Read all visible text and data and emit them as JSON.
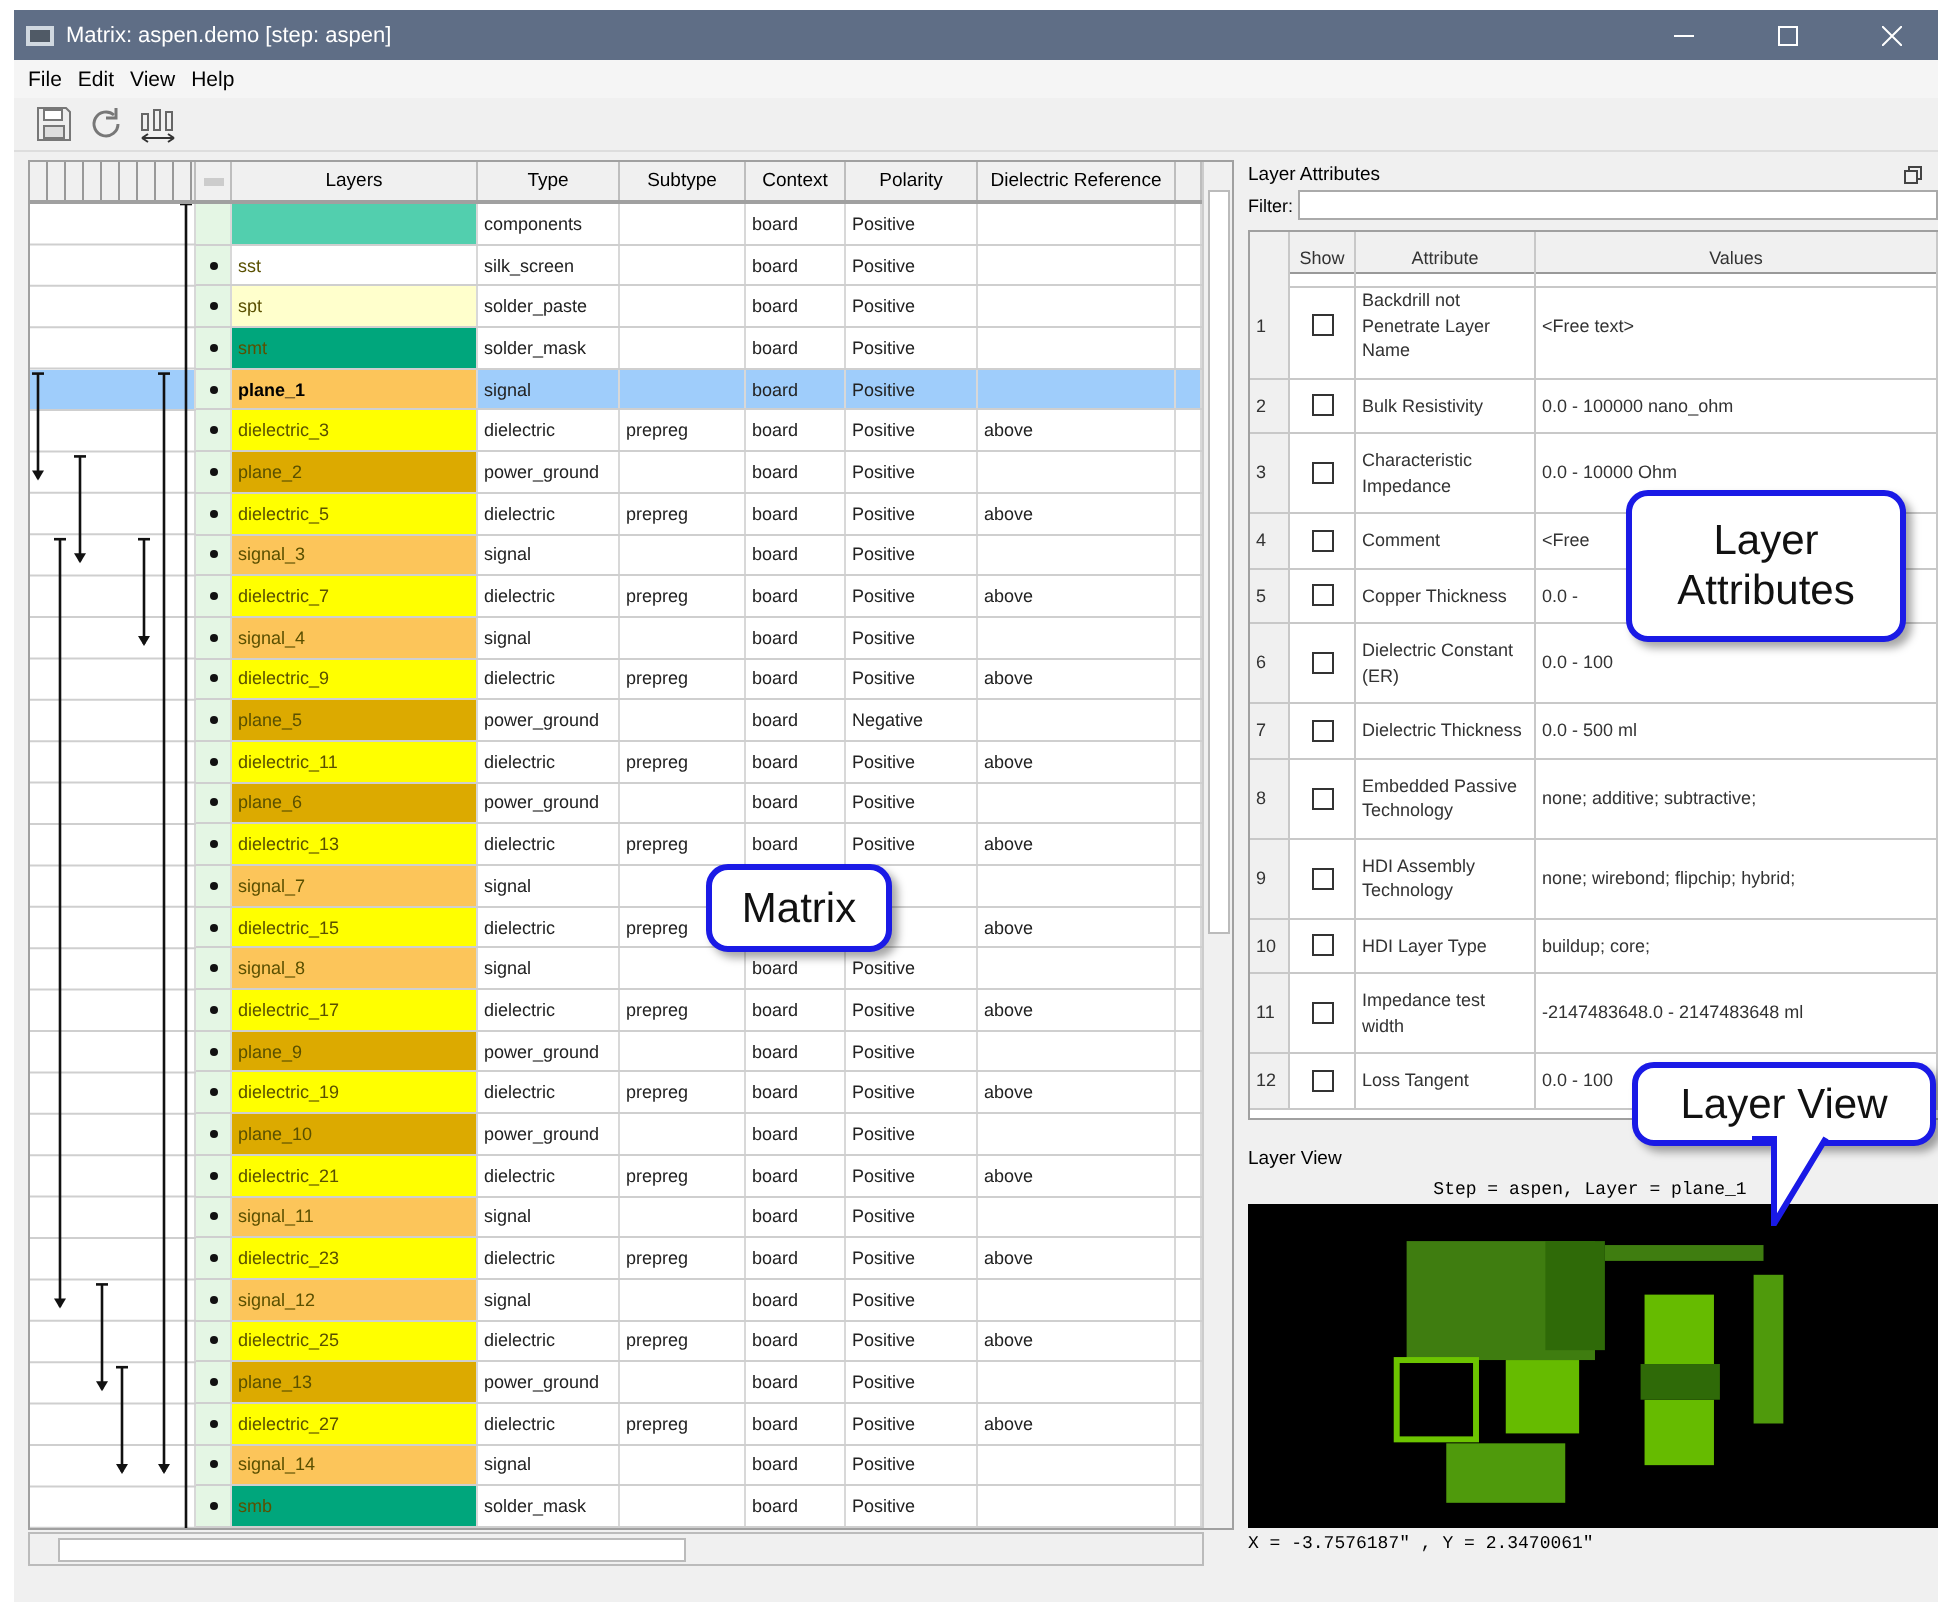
{
  "window": {
    "title": "Matrix: aspen.demo [step: aspen]"
  },
  "menu": [
    "File",
    "Edit",
    "View",
    "Help"
  ],
  "matrix": {
    "columns": [
      "Layers",
      "Type",
      "Subtype",
      "Context",
      "Polarity",
      "Dielectric Reference"
    ],
    "rows": [
      {
        "marked": false,
        "selected": false,
        "color": "#52cfae",
        "type": "components",
        "context": "board",
        "polarity": "Positive"
      },
      {
        "layer": "sst",
        "marked": true,
        "selected": false,
        "color": "#ffffff",
        "type": "silk_screen",
        "context": "board",
        "polarity": "Positive"
      },
      {
        "layer": "spt",
        "marked": true,
        "selected": false,
        "color": "#ffffcc",
        "type": "solder_paste",
        "context": "board",
        "polarity": "Positive"
      },
      {
        "layer": "smt",
        "marked": true,
        "selected": false,
        "color": "#00a67c",
        "type": "solder_mask",
        "context": "board",
        "polarity": "Positive"
      },
      {
        "layer": "plane_1",
        "marked": true,
        "selected": true,
        "color": "#fcc55a",
        "type": "signal",
        "context": "board",
        "polarity": "Positive"
      },
      {
        "layer": "dielectric_3",
        "marked": true,
        "selected": false,
        "color": "#ffff00",
        "type": "dielectric",
        "subtype": "prepreg",
        "context": "board",
        "polarity": "Positive",
        "reference": "above"
      },
      {
        "layer": "plane_2",
        "marked": true,
        "selected": false,
        "color": "#dcaa00",
        "type": "power_ground",
        "context": "board",
        "polarity": "Positive"
      },
      {
        "layer": "dielectric_5",
        "marked": true,
        "selected": false,
        "color": "#ffff00",
        "type": "dielectric",
        "subtype": "prepreg",
        "context": "board",
        "polarity": "Positive",
        "reference": "above"
      },
      {
        "layer": "signal_3",
        "marked": true,
        "selected": false,
        "color": "#fcc55a",
        "type": "signal",
        "context": "board",
        "polarity": "Positive"
      },
      {
        "layer": "dielectric_7",
        "marked": true,
        "selected": false,
        "color": "#ffff00",
        "type": "dielectric",
        "subtype": "prepreg",
        "context": "board",
        "polarity": "Positive",
        "reference": "above"
      },
      {
        "layer": "signal_4",
        "marked": true,
        "selected": false,
        "color": "#fcc55a",
        "type": "signal",
        "context": "board",
        "polarity": "Positive"
      },
      {
        "layer": "dielectric_9",
        "marked": true,
        "selected": false,
        "color": "#ffff00",
        "type": "dielectric",
        "subtype": "prepreg",
        "context": "board",
        "polarity": "Positive",
        "reference": "above"
      },
      {
        "layer": "plane_5",
        "marked": true,
        "selected": false,
        "color": "#dcaa00",
        "type": "power_ground",
        "context": "board",
        "polarity": "Negative"
      },
      {
        "layer": "dielectric_11",
        "marked": true,
        "selected": false,
        "color": "#ffff00",
        "type": "dielectric",
        "subtype": "prepreg",
        "context": "board",
        "polarity": "Positive",
        "reference": "above"
      },
      {
        "layer": "plane_6",
        "marked": true,
        "selected": false,
        "color": "#dcaa00",
        "type": "power_ground",
        "context": "board",
        "polarity": "Positive"
      },
      {
        "layer": "dielectric_13",
        "marked": true,
        "selected": false,
        "color": "#ffff00",
        "type": "dielectric",
        "subtype": "prepreg",
        "context": "board",
        "polarity": "Positive",
        "reference": "above"
      },
      {
        "layer": "signal_7",
        "marked": true,
        "selected": false,
        "color": "#fcc55a",
        "type": "signal"
      },
      {
        "layer": "dielectric_15",
        "marked": true,
        "selected": false,
        "color": "#ffff00",
        "type": "dielectric",
        "subtype": "prepreg",
        "reference": "above"
      },
      {
        "layer": "signal_8",
        "marked": true,
        "selected": false,
        "color": "#fcc55a",
        "type": "signal",
        "context": "board",
        "polarity": "Positive"
      },
      {
        "layer": "dielectric_17",
        "marked": true,
        "selected": false,
        "color": "#ffff00",
        "type": "dielectric",
        "subtype": "prepreg",
        "context": "board",
        "polarity": "Positive",
        "reference": "above"
      },
      {
        "layer": "plane_9",
        "marked": true,
        "selected": false,
        "color": "#dcaa00",
        "type": "power_ground",
        "context": "board",
        "polarity": "Positive"
      },
      {
        "layer": "dielectric_19",
        "marked": true,
        "selected": false,
        "color": "#ffff00",
        "type": "dielectric",
        "subtype": "prepreg",
        "context": "board",
        "polarity": "Positive",
        "reference": "above"
      },
      {
        "layer": "plane_10",
        "marked": true,
        "selected": false,
        "color": "#dcaa00",
        "type": "power_ground",
        "context": "board",
        "polarity": "Positive"
      },
      {
        "layer": "dielectric_21",
        "marked": true,
        "selected": false,
        "color": "#ffff00",
        "type": "dielectric",
        "subtype": "prepreg",
        "context": "board",
        "polarity": "Positive",
        "reference": "above"
      },
      {
        "layer": "signal_11",
        "marked": true,
        "selected": false,
        "color": "#fcc55a",
        "type": "signal",
        "context": "board",
        "polarity": "Positive"
      },
      {
        "layer": "dielectric_23",
        "marked": true,
        "selected": false,
        "color": "#ffff00",
        "type": "dielectric",
        "subtype": "prepreg",
        "context": "board",
        "polarity": "Positive",
        "reference": "above"
      },
      {
        "layer": "signal_12",
        "marked": true,
        "selected": false,
        "color": "#fcc55a",
        "type": "signal",
        "context": "board",
        "polarity": "Positive"
      },
      {
        "layer": "dielectric_25",
        "marked": true,
        "selected": false,
        "color": "#ffff00",
        "type": "dielectric",
        "subtype": "prepreg",
        "context": "board",
        "polarity": "Positive",
        "reference": "above"
      },
      {
        "layer": "plane_13",
        "marked": true,
        "selected": false,
        "color": "#dcaa00",
        "type": "power_ground",
        "context": "board",
        "polarity": "Positive"
      },
      {
        "layer": "dielectric_27",
        "marked": true,
        "selected": false,
        "color": "#ffff00",
        "type": "dielectric",
        "subtype": "prepreg",
        "context": "board",
        "polarity": "Positive",
        "reference": "above"
      },
      {
        "layer": "signal_14",
        "marked": true,
        "selected": false,
        "color": "#fcc55a",
        "type": "signal",
        "context": "board",
        "polarity": "Positive"
      },
      {
        "layer": "smb",
        "marked": true,
        "selected": false,
        "color": "#00a67c",
        "type": "solder_mask",
        "context": "board",
        "polarity": "Positive"
      }
    ]
  },
  "attributes": {
    "title": "Layer Attributes",
    "filter_label": "Filter:",
    "columns": [
      "Show",
      "Attribute",
      "Values"
    ],
    "rows": [
      {
        "index": "1",
        "show": false,
        "attribute": "Backdrill not Penetrate Layer Name",
        "values": "<Free text>"
      },
      {
        "index": "2",
        "show": false,
        "attribute": "Bulk Resistivity",
        "values": "0.0 - 100000 nano_ohm"
      },
      {
        "index": "3",
        "show": false,
        "attribute": "Characteristic Impedance",
        "values": "0.0 - 10000 Ohm"
      },
      {
        "index": "4",
        "show": false,
        "attribute": "Comment",
        "values": "<Free"
      },
      {
        "index": "5",
        "show": false,
        "attribute": "Copper Thickness",
        "values": "0.0 -"
      },
      {
        "index": "6",
        "show": false,
        "attribute": "Dielectric Constant (ER)",
        "values": "0.0 - 100"
      },
      {
        "index": "7",
        "show": false,
        "attribute": "Dielectric Thickness",
        "values": "0.0 - 500 ml"
      },
      {
        "index": "8",
        "show": false,
        "attribute": "Embedded Passive Technology",
        "values": "none; additive; subtractive;"
      },
      {
        "index": "9",
        "show": false,
        "attribute": "HDI Assembly Technology",
        "values": "none; wirebond; flipchip; hybrid;"
      },
      {
        "index": "10",
        "show": false,
        "attribute": "HDI Layer Type",
        "values": "buildup; core;"
      },
      {
        "index": "11",
        "show": false,
        "attribute": "Impedance test width",
        "values": "-2147483648.0 - 2147483648 ml"
      },
      {
        "index": "12",
        "show": false,
        "attribute": "Loss Tangent",
        "values": "0.0 - 100"
      }
    ]
  },
  "layer_view": {
    "title": "Layer View",
    "caption": "Step = aspen, Layer = plane_1",
    "coordinates": "X = -3.7576187\" , Y = 2.3470061\""
  },
  "callouts": [
    {
      "kind": "matrix",
      "text": "Matrix"
    },
    {
      "kind": "attributes",
      "text": "Layer Attributes"
    },
    {
      "kind": "view",
      "text": "Layer View"
    }
  ]
}
